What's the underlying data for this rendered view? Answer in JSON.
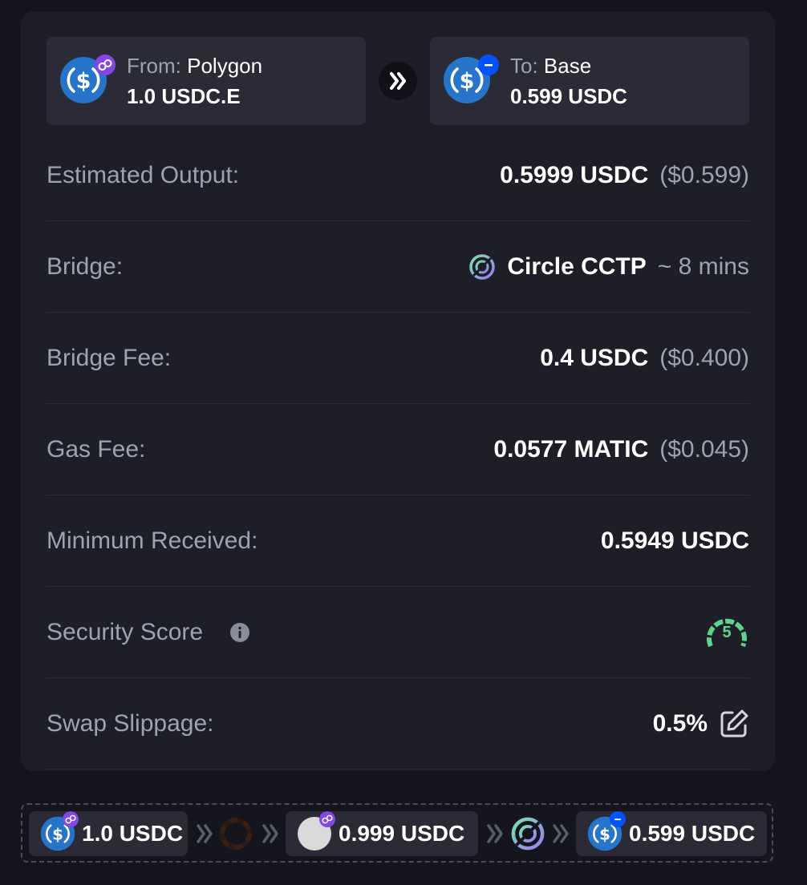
{
  "from": {
    "label": "From:",
    "chain": "Polygon",
    "amount": "1.0 USDC.E",
    "token_icon": "usdc-icon",
    "chain_icon": "polygon-icon"
  },
  "to": {
    "label": "To:",
    "chain": "Base",
    "amount": "0.599 USDC",
    "token_icon": "usdc-icon",
    "chain_icon": "base-icon"
  },
  "details": {
    "estimated_output": {
      "label": "Estimated Output:",
      "value": "0.5999 USDC",
      "usd": "($0.599)"
    },
    "bridge": {
      "label": "Bridge:",
      "name": "Circle CCTP",
      "time": "~ 8 mins",
      "icon": "circle-cctp-icon"
    },
    "bridge_fee": {
      "label": "Bridge Fee:",
      "value": "0.4 USDC",
      "usd": "($0.400)"
    },
    "gas_fee": {
      "label": "Gas Fee:",
      "value": "0.0577 MATIC",
      "usd": "($0.045)"
    },
    "minimum_received": {
      "label": "Minimum Received:",
      "value": "0.5949 USDC"
    },
    "security_score": {
      "label": "Security Score",
      "score": "5"
    },
    "swap_slippage": {
      "label": "Swap Slippage:",
      "value": "0.5%"
    }
  },
  "route": {
    "step1": "1.0 USDC",
    "step2": "0.999 USDC",
    "step3": "0.599 USDC"
  },
  "colors": {
    "background": "#15161d",
    "card": "#1d1e27",
    "panel": "#2a2b36",
    "muted_text": "#a0a2b0",
    "usdc_blue": "#2775ca",
    "polygon_purple": "#8247e5",
    "base_blue": "#0052ff",
    "score_green": "#5fd38d"
  }
}
